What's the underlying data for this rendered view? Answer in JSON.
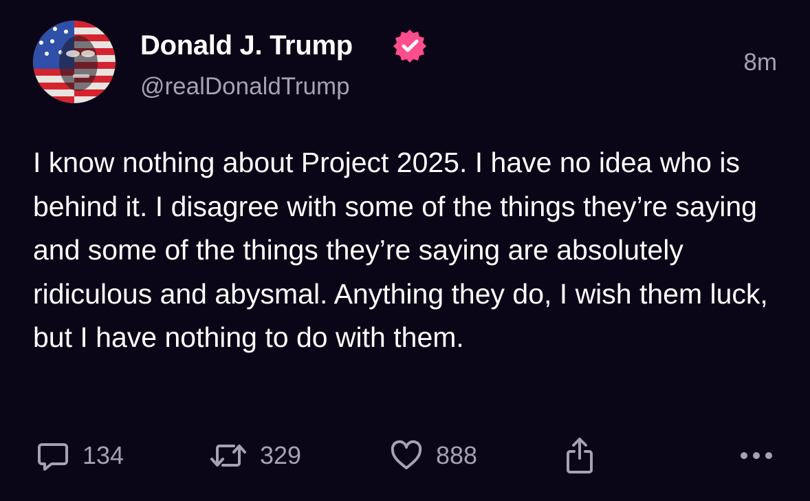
{
  "post": {
    "author": {
      "display_name": "Donald J. Trump",
      "handle": "@realDonaldTrump",
      "verified_icon": "verified-badge-icon",
      "badge_color": "#ff4d8d"
    },
    "timestamp": "8m",
    "text": "I know nothing about Project 2025. I have no idea who is behind it. I disagree with some of the things they’re saying and some of the things they’re saying are absolutely ridiculous and abysmal. Anything they do, I wish them luck, but I have nothing to do with them.",
    "actions": {
      "reply": {
        "icon": "reply-icon",
        "count": "134"
      },
      "repost": {
        "icon": "repost-icon",
        "count": "329"
      },
      "like": {
        "icon": "heart-icon",
        "count": "888"
      },
      "share": {
        "icon": "share-icon"
      },
      "more": {
        "icon": "more-icon"
      }
    }
  },
  "colors": {
    "background": "#0b0617",
    "text": "#ffffff",
    "muted": "#a6a1b3",
    "accent": "#ff4d8d"
  }
}
